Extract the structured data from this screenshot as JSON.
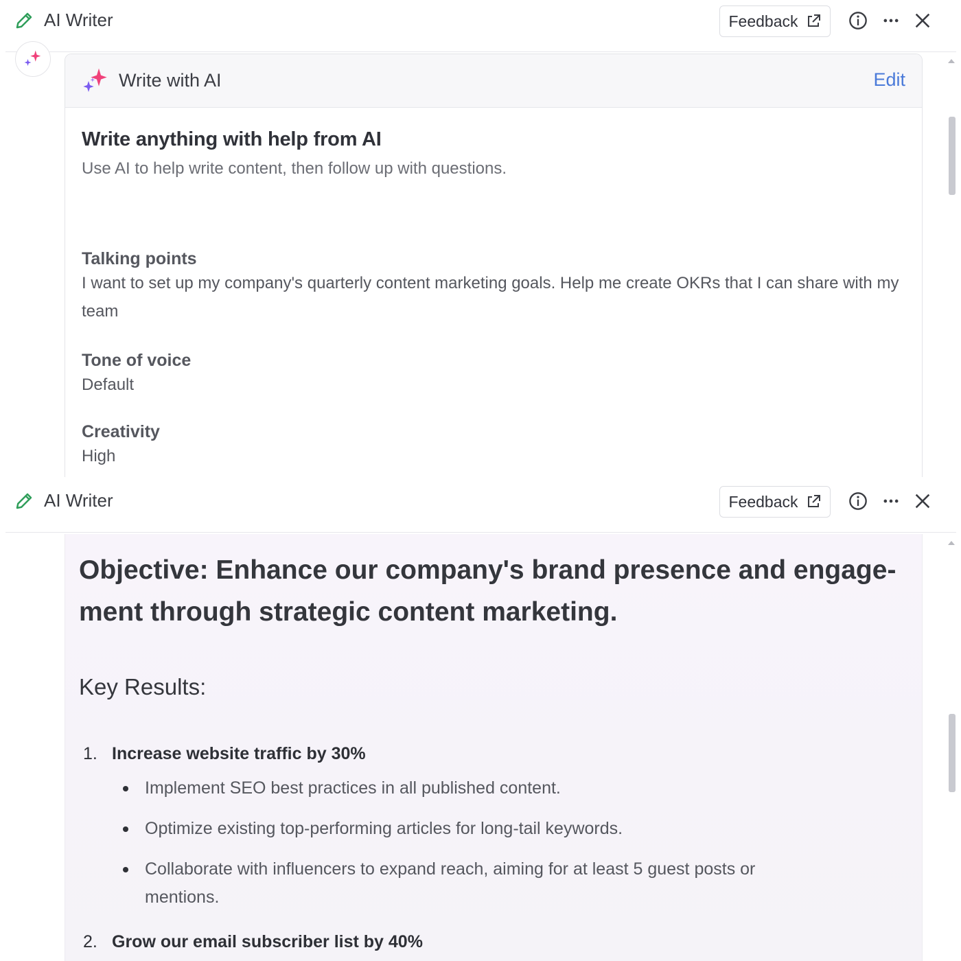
{
  "app": {
    "title": "AI Writer",
    "feedback_label": "Feedback",
    "icons": [
      "pencil-icon",
      "external-link-icon",
      "info-icon",
      "more-icon",
      "close-icon"
    ]
  },
  "prompt_card": {
    "header_label": "Write with AI",
    "edit_label": "Edit",
    "heading": "Write anything with help from AI",
    "subheading": "Use AI to help write content, then follow up with questions.",
    "fields": [
      {
        "label": "Talking points",
        "value": "I want to set up my company's quarterly content marketing goals. Help me create OKRs that I can share with my team"
      },
      {
        "label": "Tone of voice",
        "value": "Default"
      },
      {
        "label": "Creativity",
        "value": "High"
      }
    ]
  },
  "output": {
    "objective": "Objective: Enhance our company's brand presence and engage-ment through strategic content marketing.",
    "key_results_title": "Key Results:",
    "key_results": [
      {
        "num": "1.",
        "title": "Increase website traffic by 30%",
        "bullets": [
          "Implement SEO best practices in all published content.",
          "Optimize existing top-performing articles for long-tail keywords.",
          "Collaborate with influencers to expand reach, aiming for at least 5 guest posts or mentions."
        ]
      },
      {
        "num": "2.",
        "title": "Grow our email subscriber list by 40%",
        "bullets": []
      }
    ]
  },
  "colors": {
    "accent_edit": "#4a7ad9",
    "pencil_green": "#2f9e5a",
    "sparkle_pink": "#f0417a",
    "sparkle_purple": "#7b5cf0"
  }
}
